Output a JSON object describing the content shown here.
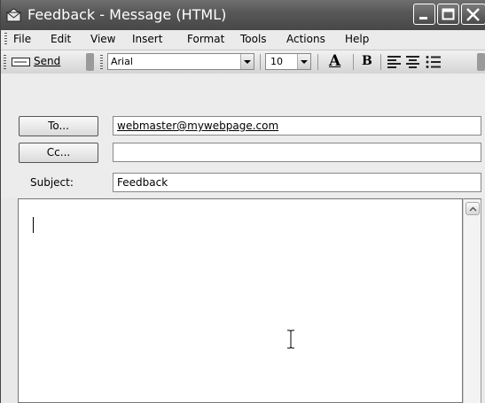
{
  "window": {
    "title": "Feedback - Message (HTML)",
    "icon": "envelope-icon",
    "controls": [
      "minimize-icon",
      "maximize-icon",
      "close-icon"
    ]
  },
  "menu": {
    "items": [
      {
        "label": "File"
      },
      {
        "label": "Edit"
      },
      {
        "label": "View"
      },
      {
        "label": "Insert"
      },
      {
        "label": "Format"
      },
      {
        "label": "Tools"
      },
      {
        "label": "Actions"
      },
      {
        "label": "Help"
      }
    ]
  },
  "toolbar": {
    "send_label": "Send",
    "font_name": "Arial",
    "font_size": "10",
    "font_color_label": "A",
    "bold_label": "B",
    "align_icons": [
      "align-left-icon",
      "align-center-icon",
      "bullets-icon"
    ]
  },
  "header": {
    "to_button": "To...",
    "to_value": "webmaster@mywebpage.com",
    "cc_button": "Cc...",
    "cc_value": "",
    "subject_label": "Subject:",
    "subject_value": "Feedback"
  },
  "body": {
    "text": ""
  }
}
